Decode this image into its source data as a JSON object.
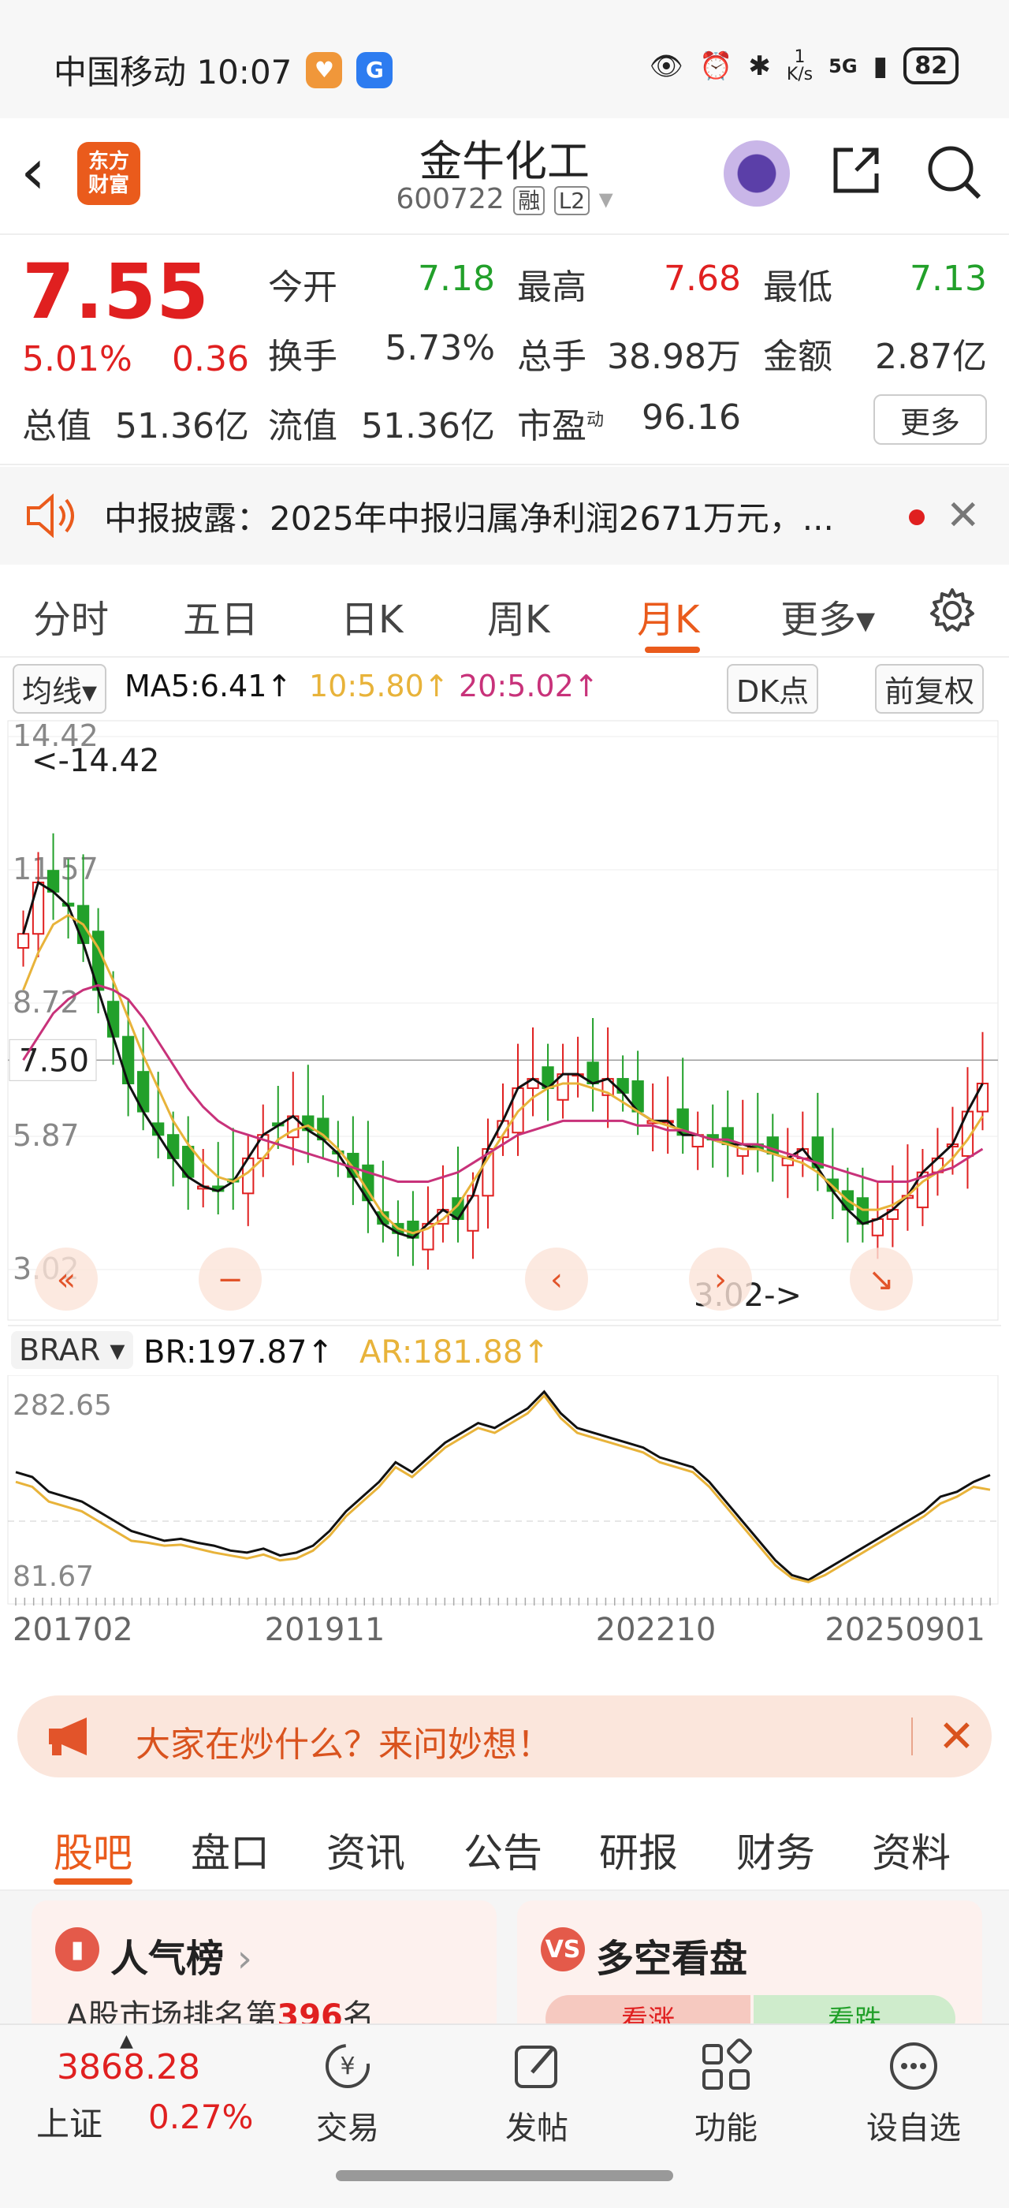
{
  "status_bar": {
    "carrier_time": "中国移动 10:07",
    "net_speed": "1\nK/s",
    "network": "5G",
    "battery": "82"
  },
  "header": {
    "logo_text": "东方\n财富",
    "stock_name": "金牛化工",
    "stock_code": "600722",
    "tag_margin": "融",
    "tag_level": "L2"
  },
  "quote": {
    "price": "7.55",
    "change_pct": "5.01%",
    "change": "0.36",
    "open_label": "今开",
    "open_value": "7.18",
    "high_label": "最高",
    "high_value": "7.68",
    "low_label": "最低",
    "low_value": "7.13",
    "turnover_label": "换手",
    "turnover_value": "5.73%",
    "volume_label": "总手",
    "volume_value": "38.98万",
    "amount_label": "金额",
    "amount_value": "2.87亿",
    "mktcap_label": "总值",
    "mktcap_value": "51.36亿",
    "float_label": "流值",
    "float_value": "51.36亿",
    "pe_label": "市盈",
    "pe_sup": "动",
    "pe_value": "96.16",
    "more": "更多"
  },
  "notice": {
    "text": "中报披露：2025年中报归属净利润2671万元，..."
  },
  "tabs": [
    "分时",
    "五日",
    "日K",
    "周K",
    "月K",
    "更多▾"
  ],
  "active_tab": "月K",
  "chart_toolbar": {
    "ma_select": "均线▾",
    "ma5": "MA5:6.41↑",
    "ma10": "10:5.80↑",
    "ma20": "20:5.02↑",
    "dk": "DK点",
    "adjust": "前复权"
  },
  "colors": {
    "up": "#e02020",
    "down": "#22a02a",
    "ma5": "#111111",
    "ma10": "#e8b33a",
    "ma20": "#c8327a",
    "accent": "#ea5b1c"
  },
  "chart_data": [
    {
      "type": "candlestick",
      "title": "",
      "y_ticks": [
        "14.42",
        "11.57",
        "8.72",
        "5.87",
        "3.02"
      ],
      "ylim": [
        3.02,
        14.42
      ],
      "current_price_label": "7.50",
      "max_annotation": "<-14.42",
      "min_annotation": "3.02->",
      "series": [
        {
          "name": "MA5",
          "values": [
            10.2,
            11.3,
            11.1,
            10.8,
            10.0,
            9.0,
            8.0,
            7.0,
            6.4,
            5.9,
            5.4,
            5.0,
            4.8,
            4.7,
            4.9,
            5.4,
            5.9,
            6.1,
            6.3,
            6.0,
            5.8,
            5.5,
            5.0,
            4.5,
            4.0,
            3.8,
            3.7,
            4.0,
            4.3,
            4.1,
            4.6,
            5.6,
            6.2,
            6.9,
            7.1,
            6.9,
            7.2,
            7.2,
            7.0,
            7.1,
            6.8,
            6.4,
            6.2,
            6.2,
            5.9,
            5.9,
            5.8,
            5.7,
            5.7,
            5.6,
            5.5,
            5.4,
            5.6,
            5.2,
            4.7,
            4.3,
            4.0,
            4.1,
            4.3,
            4.6,
            5.1,
            5.4,
            5.7,
            6.4,
            7.0
          ]
        },
        {
          "name": "MA10",
          "values": [
            9.0,
            9.8,
            10.4,
            10.6,
            10.4,
            9.9,
            9.2,
            8.4,
            7.6,
            6.9,
            6.2,
            5.7,
            5.3,
            5.0,
            4.9,
            5.1,
            5.4,
            5.8,
            6.0,
            6.1,
            5.9,
            5.6,
            5.2,
            4.7,
            4.2,
            3.9,
            3.8,
            3.9,
            4.1,
            4.4,
            4.9,
            5.4,
            5.9,
            6.4,
            6.7,
            6.9,
            7.0,
            7.0,
            6.9,
            6.8,
            6.6,
            6.4,
            6.2,
            6.1,
            6.0,
            5.9,
            5.8,
            5.7,
            5.6,
            5.6,
            5.5,
            5.4,
            5.3,
            5.1,
            4.8,
            4.5,
            4.3,
            4.3,
            4.4,
            4.6,
            4.9,
            5.1,
            5.4,
            5.8,
            6.3
          ]
        },
        {
          "name": "MA20",
          "values": [
            7.5,
            8.0,
            8.5,
            8.8,
            9.0,
            9.1,
            9.0,
            8.8,
            8.4,
            7.9,
            7.4,
            6.9,
            6.5,
            6.2,
            6.0,
            5.9,
            5.8,
            5.7,
            5.6,
            5.5,
            5.4,
            5.3,
            5.2,
            5.1,
            5.0,
            4.9,
            4.9,
            4.9,
            5.0,
            5.1,
            5.3,
            5.5,
            5.7,
            5.9,
            6.0,
            6.1,
            6.2,
            6.2,
            6.2,
            6.2,
            6.2,
            6.1,
            6.1,
            6.0,
            6.0,
            5.9,
            5.8,
            5.8,
            5.7,
            5.7,
            5.6,
            5.5,
            5.4,
            5.3,
            5.2,
            5.1,
            5.0,
            4.9,
            4.9,
            4.9,
            5.0,
            5.1,
            5.2,
            5.4,
            5.6
          ]
        }
      ]
    },
    {
      "type": "line",
      "indicator": "BRAR",
      "br_label": "BR:197.87↑",
      "ar_label": "AR:181.88↑",
      "y_ticks": [
        "282.65",
        "81.67"
      ],
      "ylim": [
        81.67,
        282.65
      ],
      "x_ticks": [
        "201702",
        "201911",
        "202210",
        "20250901"
      ],
      "series": [
        {
          "name": "BR",
          "values": [
            200,
            195,
            180,
            175,
            170,
            160,
            150,
            140,
            135,
            130,
            132,
            128,
            125,
            120,
            118,
            122,
            115,
            118,
            125,
            140,
            160,
            175,
            190,
            210,
            200,
            215,
            230,
            240,
            250,
            245,
            255,
            265,
            282,
            260,
            245,
            240,
            235,
            230,
            225,
            215,
            210,
            205,
            190,
            170,
            150,
            130,
            110,
            95,
            90,
            100,
            110,
            120,
            130,
            140,
            150,
            160,
            175,
            180,
            190,
            197
          ]
        },
        {
          "name": "AR",
          "values": [
            190,
            185,
            170,
            165,
            160,
            150,
            140,
            130,
            128,
            125,
            126,
            122,
            118,
            115,
            112,
            116,
            110,
            112,
            120,
            135,
            155,
            170,
            185,
            205,
            195,
            210,
            225,
            235,
            245,
            240,
            250,
            260,
            278,
            255,
            240,
            235,
            230,
            225,
            220,
            210,
            205,
            200,
            185,
            165,
            145,
            125,
            105,
            92,
            88,
            95,
            105,
            115,
            125,
            135,
            145,
            155,
            168,
            175,
            185,
            182
          ]
        }
      ]
    }
  ],
  "ask_bar": {
    "text": "大家在炒什么？来问妙想！"
  },
  "bottom_tabs": [
    "股吧",
    "盘口",
    "资讯",
    "公告",
    "研报",
    "财务",
    "资料"
  ],
  "active_bottom_tab": "股吧",
  "cards": {
    "rank_title": "人气榜",
    "rank_sub_prefix": "A股市场排名第",
    "rank_number": "396",
    "rank_sub_suffix": "名",
    "vs_title": "多空看盘",
    "vs_up": "看涨",
    "vs_down": "看跌"
  },
  "nav": {
    "index_value": "3868.28",
    "index_name": "上证",
    "index_pct": "0.27%",
    "items": [
      "交易",
      "发帖",
      "功能",
      "设自选"
    ]
  }
}
